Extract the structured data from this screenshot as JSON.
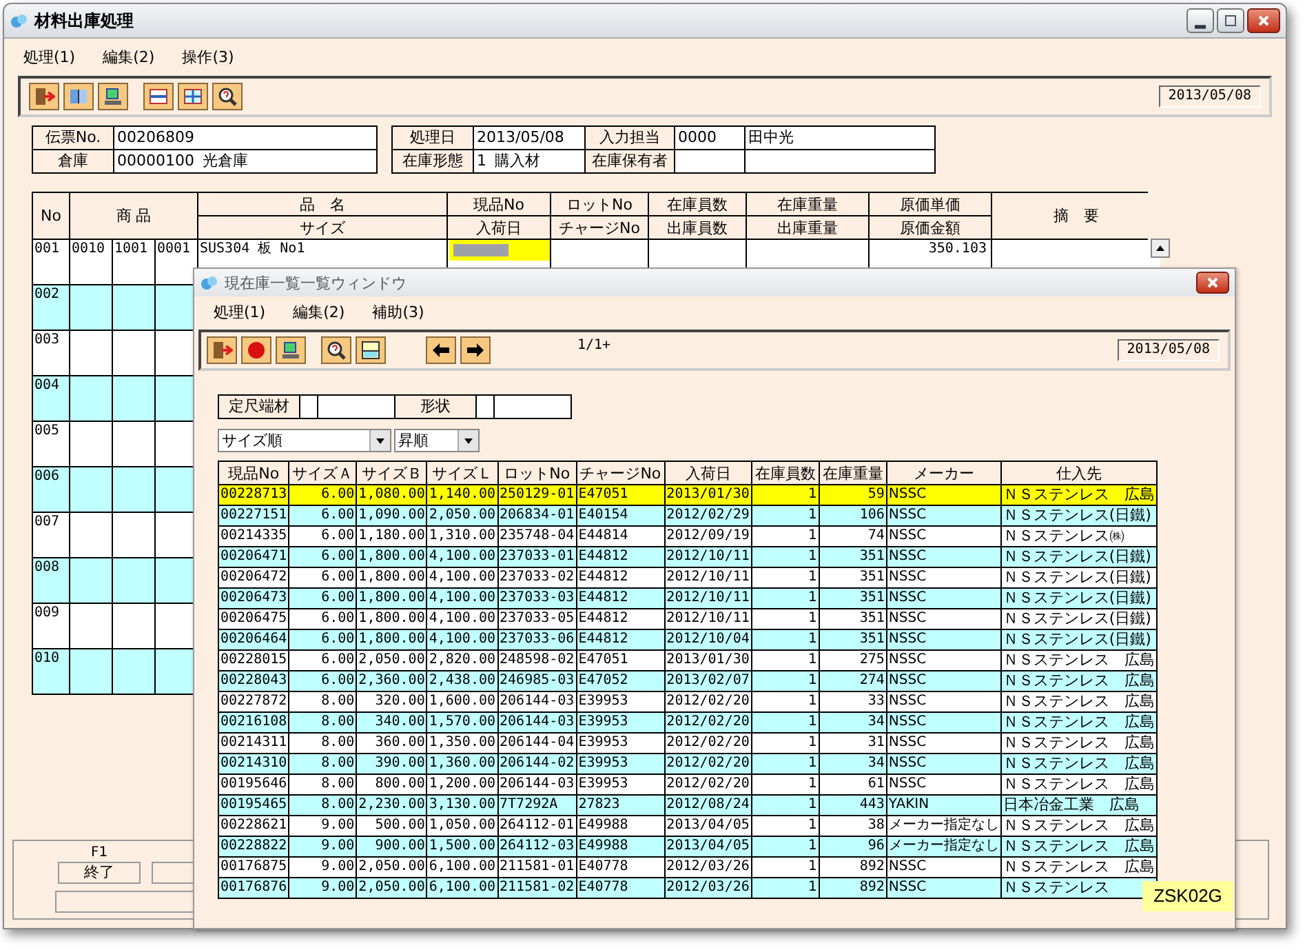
{
  "window": {
    "title": "材料出庫処理"
  },
  "menu": [
    "処理(1)",
    "編集(2)",
    "操作(3)"
  ],
  "toolbar_date": "2013/05/08",
  "header_left": [
    {
      "label": "伝票No.",
      "values": [
        "00206809"
      ]
    },
    {
      "label": "倉庫",
      "values": [
        "00000100",
        "光倉庫"
      ]
    }
  ],
  "header_right": [
    {
      "label": "処理日",
      "values": [
        "2013/05/08"
      ],
      "label2": "入力担当",
      "values2": [
        "0000",
        "田中光"
      ]
    },
    {
      "label": "在庫形態",
      "values": [
        "1",
        "購入材"
      ],
      "label2": "在庫保有者"
    }
  ],
  "table": {
    "columns": [
      {
        "top": "No"
      },
      {
        "top": "商 品"
      },
      {
        "top": "品　名",
        "bottom": "サイズ"
      },
      {
        "top": "現品No",
        "bottom": "入荷日"
      },
      {
        "top": "ロットNo",
        "bottom": "チャージNo"
      },
      {
        "top": "在庫員数",
        "bottom": "出庫員数"
      },
      {
        "top": "在庫重量",
        "bottom": "出庫重量"
      },
      {
        "top": "原価単価",
        "bottom": "原価金額"
      },
      {
        "top": "摘　要"
      }
    ],
    "rows": [
      {
        "no": "001",
        "codes": [
          "0010",
          "1001",
          "0001"
        ],
        "name": "SUS304 板 No1",
        "unit_cost": "350.103",
        "editing": true
      },
      {
        "no": "002"
      },
      {
        "no": "003"
      },
      {
        "no": "004"
      },
      {
        "no": "005"
      },
      {
        "no": "006"
      },
      {
        "no": "007"
      },
      {
        "no": "008"
      },
      {
        "no": "009"
      },
      {
        "no": "010"
      }
    ]
  },
  "function_keys": [
    {
      "key": "F1",
      "label": "終了"
    }
  ],
  "popup": {
    "title": "現在庫一覧一覧ウィンドウ",
    "menu": [
      "処理(1)",
      "編集(2)",
      "補助(3)"
    ],
    "page": "1/1+",
    "date": "2013/05/08",
    "filters": [
      "定尺端材",
      "形状"
    ],
    "sort": [
      "サイズ順",
      "昇順"
    ],
    "columns": [
      "現品No",
      "サイズＡ",
      "サイズＢ",
      "サイズＬ",
      "ロットNo",
      "チャージNo",
      "入荷日",
      "在庫員数",
      "在庫重量",
      "メーカー",
      "仕入先"
    ],
    "rows": [
      {
        "selected": true,
        "cells": [
          "00228713",
          "6.00",
          "1,080.00",
          "1,140.00",
          "250129-01",
          "E47051",
          "2013/01/30",
          "1",
          "59",
          "NSSC",
          "ＮＳステンレス　広島"
        ]
      },
      {
        "selected": false,
        "cells": [
          "00227151",
          "6.00",
          "1,090.00",
          "2,050.00",
          "206834-01",
          "E40154",
          "2012/02/29",
          "1",
          "106",
          "NSSC",
          "ＮＳステンレス(日鐵)"
        ]
      },
      {
        "selected": false,
        "cells": [
          "00214335",
          "6.00",
          "1,180.00",
          "1,310.00",
          "235748-04",
          "E44814",
          "2012/09/19",
          "1",
          "74",
          "NSSC",
          "ＮＳステンレス㈱"
        ]
      },
      {
        "selected": false,
        "cells": [
          "00206471",
          "6.00",
          "1,800.00",
          "4,100.00",
          "237033-01",
          "E44812",
          "2012/10/11",
          "1",
          "351",
          "NSSC",
          "ＮＳステンレス(日鐵)"
        ]
      },
      {
        "selected": false,
        "cells": [
          "00206472",
          "6.00",
          "1,800.00",
          "4,100.00",
          "237033-02",
          "E44812",
          "2012/10/11",
          "1",
          "351",
          "NSSC",
          "ＮＳステンレス(日鐵)"
        ]
      },
      {
        "selected": false,
        "cells": [
          "00206473",
          "6.00",
          "1,800.00",
          "4,100.00",
          "237033-03",
          "E44812",
          "2012/10/11",
          "1",
          "351",
          "NSSC",
          "ＮＳステンレス(日鐵)"
        ]
      },
      {
        "selected": false,
        "cells": [
          "00206475",
          "6.00",
          "1,800.00",
          "4,100.00",
          "237033-05",
          "E44812",
          "2012/10/11",
          "1",
          "351",
          "NSSC",
          "ＮＳステンレス(日鐵)"
        ]
      },
      {
        "selected": false,
        "cells": [
          "00206464",
          "6.00",
          "1,800.00",
          "4,100.00",
          "237033-06",
          "E44812",
          "2012/10/04",
          "1",
          "351",
          "NSSC",
          "ＮＳステンレス(日鐵)"
        ]
      },
      {
        "selected": false,
        "cells": [
          "00228015",
          "6.00",
          "2,050.00",
          "2,820.00",
          "248598-02",
          "E47051",
          "2013/01/30",
          "1",
          "275",
          "NSSC",
          "ＮＳステンレス　広島"
        ]
      },
      {
        "selected": false,
        "cells": [
          "00228043",
          "6.00",
          "2,360.00",
          "2,438.00",
          "246985-03",
          "E47052",
          "2013/02/07",
          "1",
          "274",
          "NSSC",
          "ＮＳステンレス　広島"
        ]
      },
      {
        "selected": false,
        "cells": [
          "00227872",
          "8.00",
          "320.00",
          "1,600.00",
          "206144-03",
          "E39953",
          "2012/02/20",
          "1",
          "33",
          "NSSC",
          "ＮＳステンレス　広島"
        ]
      },
      {
        "selected": false,
        "cells": [
          "00216108",
          "8.00",
          "340.00",
          "1,570.00",
          "206144-03",
          "E39953",
          "2012/02/20",
          "1",
          "34",
          "NSSC",
          "ＮＳステンレス　広島"
        ]
      },
      {
        "selected": false,
        "cells": [
          "00214311",
          "8.00",
          "360.00",
          "1,350.00",
          "206144-04",
          "E39953",
          "2012/02/20",
          "1",
          "31",
          "NSSC",
          "ＮＳステンレス　広島"
        ]
      },
      {
        "selected": false,
        "cells": [
          "00214310",
          "8.00",
          "390.00",
          "1,360.00",
          "206144-02",
          "E39953",
          "2012/02/20",
          "1",
          "34",
          "NSSC",
          "ＮＳステンレス　広島"
        ]
      },
      {
        "selected": false,
        "cells": [
          "00195646",
          "8.00",
          "800.00",
          "1,200.00",
          "206144-03",
          "E39953",
          "2012/02/20",
          "1",
          "61",
          "NSSC",
          "ＮＳステンレス　広島"
        ]
      },
      {
        "selected": false,
        "cells": [
          "00195465",
          "8.00",
          "2,230.00",
          "3,130.00",
          "7T7292A",
          "27823",
          "2012/08/24",
          "1",
          "443",
          "YAKIN",
          "日本冶金工業　広島"
        ]
      },
      {
        "selected": false,
        "cells": [
          "00228621",
          "9.00",
          "500.00",
          "1,050.00",
          "264112-01",
          "E49988",
          "2013/04/05",
          "1",
          "38",
          "メーカー指定なし",
          "ＮＳステンレス　広島"
        ]
      },
      {
        "selected": false,
        "cells": [
          "00228822",
          "9.00",
          "900.00",
          "1,500.00",
          "264112-03",
          "E49988",
          "2013/04/05",
          "1",
          "96",
          "メーカー指定なし",
          "ＮＳステンレス　広島"
        ]
      },
      {
        "selected": false,
        "cells": [
          "00176875",
          "9.00",
          "2,050.00",
          "6,100.00",
          "211581-01",
          "E40778",
          "2012/03/26",
          "1",
          "892",
          "NSSC",
          "ＮＳステンレス　広島"
        ]
      },
      {
        "selected": false,
        "cells": [
          "00176876",
          "9.00",
          "2,050.00",
          "6,100.00",
          "211581-02",
          "E40778",
          "2012/03/26",
          "1",
          "892",
          "NSSC",
          "ＮＳステンレス"
        ]
      }
    ]
  },
  "screen_id": "ZSK02G"
}
